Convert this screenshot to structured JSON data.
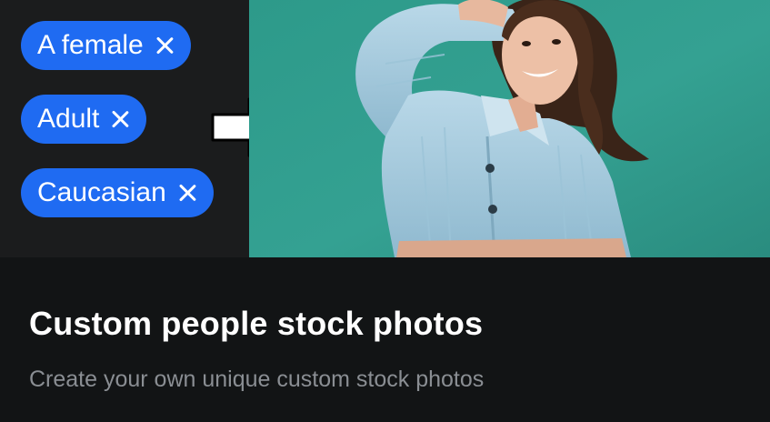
{
  "tags": [
    {
      "label": "A female"
    },
    {
      "label": "Adult"
    },
    {
      "label": "Caucasian"
    }
  ],
  "card": {
    "title": "Custom people stock photos",
    "subtitle": "Create your own unique custom stock photos"
  },
  "colors": {
    "chip": "#1f6bf2",
    "background": "#121415",
    "photo_background": "#2f9a8c"
  },
  "icons": {
    "chip_remove": "close-icon",
    "transform": "arrow-right-icon"
  }
}
